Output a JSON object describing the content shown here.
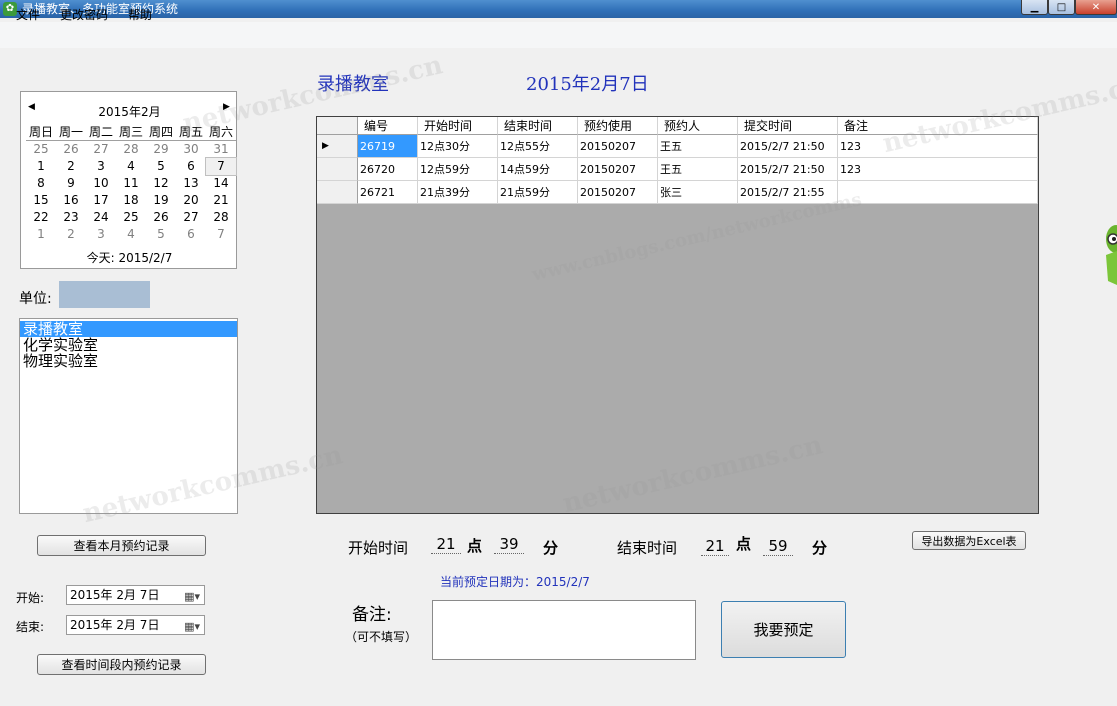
{
  "window": {
    "title": "录播教室、多功能室预约系统",
    "min_symbol": "▁",
    "max_symbol": "□",
    "close_symbol": "✕"
  },
  "menu": [
    "文件",
    "更改密码",
    "帮助"
  ],
  "calendar": {
    "month_label": "2015年2月",
    "prev_symbol": "◀",
    "next_symbol": "▶",
    "weekdays": [
      "周日",
      "周一",
      "周二",
      "周三",
      "周四",
      "周五",
      "周六"
    ],
    "rows": [
      [
        "25",
        "26",
        "27",
        "28",
        "29",
        "30",
        "31"
      ],
      [
        "1",
        "2",
        "3",
        "4",
        "5",
        "6",
        "7"
      ],
      [
        "8",
        "9",
        "10",
        "11",
        "12",
        "13",
        "14"
      ],
      [
        "15",
        "16",
        "17",
        "18",
        "19",
        "20",
        "21"
      ],
      [
        "22",
        "23",
        "24",
        "25",
        "26",
        "27",
        "28"
      ],
      [
        "1",
        "2",
        "3",
        "4",
        "5",
        "6",
        "7"
      ]
    ],
    "today_text": "今天: 2015/2/7"
  },
  "unit": {
    "label": "单位:"
  },
  "rooms": {
    "items": [
      "录播教室",
      "化学实验室",
      "物理实验室"
    ],
    "selected_index": 0
  },
  "buttons": {
    "view_month": "查看本月预约记录",
    "view_range": "查看时间段内预约记录",
    "export": "导出数据为Excel表",
    "reserve": "我要预定"
  },
  "range": {
    "start_label": "开始:",
    "end_label": "结束:",
    "start_value": "2015年  2月  7日",
    "end_value": "2015年  2月  7日"
  },
  "header": {
    "room": "录播教室",
    "date": "2015年2月7日"
  },
  "grid": {
    "columns": [
      "编号",
      "开始时间",
      "结束时间",
      "预约使用",
      "预约人",
      "提交时间",
      "备注"
    ],
    "rows": [
      [
        "26719",
        "12点30分",
        "12点55分",
        "20150207",
        "王五",
        "2015/2/7  21:50",
        "123"
      ],
      [
        "26720",
        "12点59分",
        "14点59分",
        "20150207",
        "王五",
        "2015/2/7  21:50",
        "123"
      ],
      [
        "26721",
        "21点39分",
        "21点59分",
        "20150207",
        "张三",
        "2015/2/7  21:55",
        ""
      ]
    ],
    "current_row_marker": "▶"
  },
  "time": {
    "start_label": "开始时间",
    "end_label": "结束时间",
    "start_hour": "21",
    "start_min": "39",
    "end_hour": "21",
    "end_min": "59",
    "hour_unit": "点",
    "min_unit": "分"
  },
  "current_date_text": "当前预定日期为：2015/2/7",
  "note": {
    "label": "备注:",
    "hint": "（可不填写）",
    "value": ""
  },
  "watermarks": [
    "networkcomms.cn",
    "www.cnblogs.com/networkcomms"
  ]
}
